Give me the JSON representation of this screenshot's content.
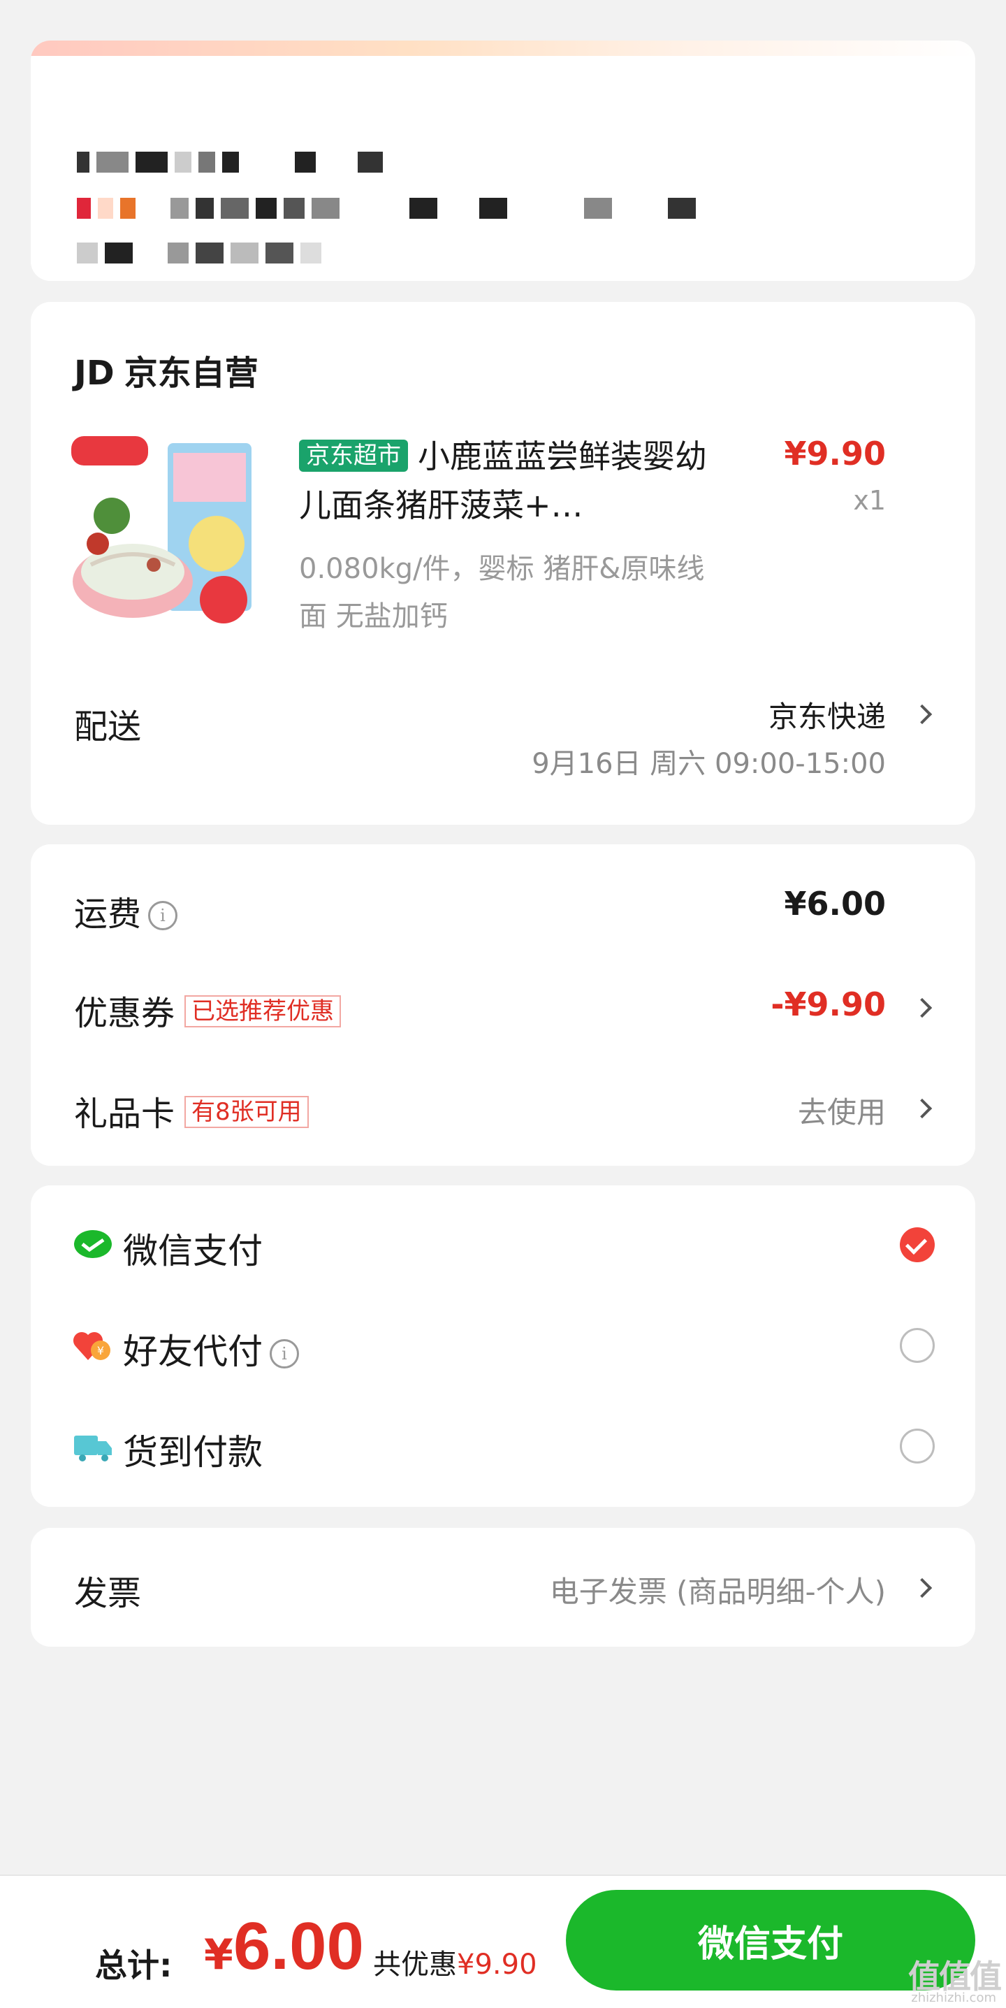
{
  "product_section": {
    "shop_logo": "JD",
    "shop_name": "京东自营",
    "product": {
      "tag": "京东超市",
      "title": "小鹿蓝蓝尝鲜装婴幼儿面条猪肝菠菜+…",
      "price": "¥9.90",
      "quantity": "x1",
      "spec": "0.080kg/件，婴标 猪肝&原味线面 无盐加钙"
    },
    "delivery": {
      "label": "配送",
      "carrier": "京东快递",
      "time": "9月16日 周六 09:00-15:00"
    }
  },
  "fees": {
    "shipping": {
      "label": "运费",
      "info_icon": "info-icon",
      "value": "¥6.00"
    },
    "coupon": {
      "label": "优惠券",
      "tag": "已选推荐优惠",
      "value": "-¥9.90"
    },
    "gift_card": {
      "label": "礼品卡",
      "tag": "有8张可用",
      "action": "去使用"
    }
  },
  "payment": {
    "options": [
      {
        "label": "微信支付",
        "icon": "wechat-pay-icon",
        "selected": true
      },
      {
        "label": "好友代付",
        "icon": "friend-pay-icon",
        "selected": false
      },
      {
        "label": "货到付款",
        "icon": "cash-on-delivery-icon",
        "selected": false
      }
    ]
  },
  "invoice": {
    "label": "发票",
    "value": "电子发票 (商品明细-个人)"
  },
  "bottom_bar": {
    "total_label": "总计:",
    "currency": "¥",
    "total_amount": "6.00",
    "discount_label": "共优惠",
    "discount_amount": "¥9.90",
    "pay_button": "微信支付"
  },
  "watermark": {
    "text": "值值值",
    "sub": "zhizhizhi.com"
  },
  "colors": {
    "accent_red": "#e02e24",
    "pay_green": "#1bb82b",
    "tag_green": "#1aa36b",
    "background": "#f2f2f2"
  }
}
